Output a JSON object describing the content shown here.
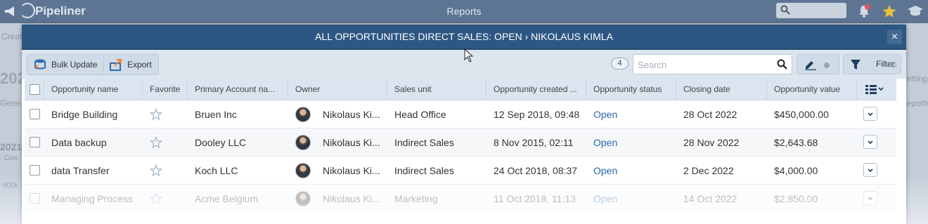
{
  "app": {
    "brand": "Pipeliner",
    "section_title": "Reports",
    "bg_labels": [
      "Creat",
      "202",
      "Gene",
      "2021",
      ": Clos",
      "600k",
      "etting",
      "eports"
    ]
  },
  "modal": {
    "title": "ALL OPPORTUNITIES DIRECT SALES: OPEN › NIKOLAUS KIMLA",
    "close_label": "×"
  },
  "toolbar": {
    "bulk_update_label": "Bulk Update",
    "export_label": "Export",
    "record_count": "4",
    "search_placeholder": "Search",
    "filter_label": "Filter"
  },
  "table": {
    "columns": [
      "Opportunity name",
      "Favorite",
      "Primary Account na...",
      "Owner",
      "Sales unit",
      "Opportunity created ...",
      "Opportunity status",
      "Closing date",
      "Opportunity value"
    ],
    "sort_indicator": "▲",
    "rows": [
      {
        "name": "Bridge Building",
        "account": "Bruen Inc",
        "owner": "Nikolaus Ki...",
        "sales_unit": "Head Office",
        "created": "12 Sep 2018, 09:48",
        "status": "Open",
        "closing": "28 Oct 2022",
        "value": "$450,000.00"
      },
      {
        "name": "Data backup",
        "account": "Dooley LLC",
        "owner": "Nikolaus Ki...",
        "sales_unit": "Indirect Sales",
        "created": "8 Nov 2015, 02:11",
        "status": "Open",
        "closing": "28 Nov 2022",
        "value": "$2,643.68"
      },
      {
        "name": "data Transfer",
        "account": "Koch LLC",
        "owner": "Nikolaus Ki...",
        "sales_unit": "Indirect Sales",
        "created": "24 Oct 2018, 08:37",
        "status": "Open",
        "closing": "2 Dec 2022",
        "value": "$4,000.00"
      },
      {
        "name": "Managing Process",
        "account": "Acme Belgium",
        "owner": "Nikolaus Ki...",
        "sales_unit": "Marketing",
        "created": "11 Oct 2018, 11:13",
        "status": "Open",
        "closing": "14 Oct 2022",
        "value": "$2,850.00"
      }
    ]
  },
  "colors": {
    "header_bg": "#2d5783",
    "toolbar_bg": "#dde6ef",
    "status_link": "#2c68a8",
    "favorite_star": "#a9b8c9"
  }
}
